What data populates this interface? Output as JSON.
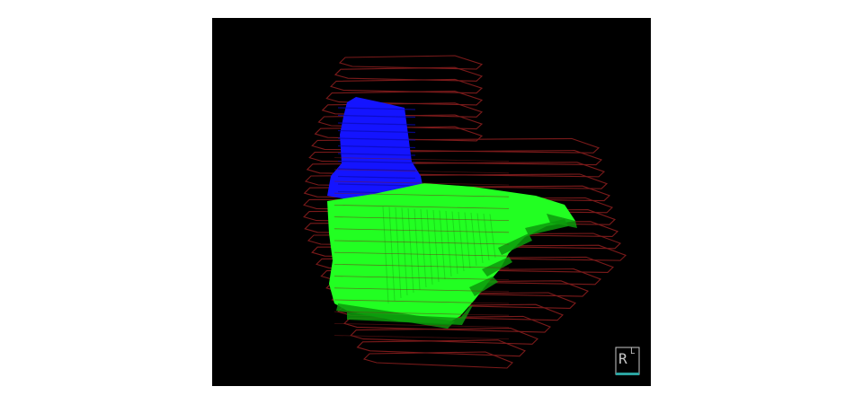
{
  "viewer": {
    "background": "#000000",
    "colors": {
      "contour": "#7a1a1a",
      "structure_upper": "#1414ff",
      "structure_upper_dark": "#0a0ab4",
      "structure_lower": "#22ff22",
      "structure_lower_dark": "#0c9a0c",
      "widget_frame": "#c8c8c8",
      "widget_accent": "#2aa3a0"
    },
    "orientation_widget": {
      "icon": "axis-orientation-icon",
      "label": "R",
      "superscript": "L"
    }
  }
}
